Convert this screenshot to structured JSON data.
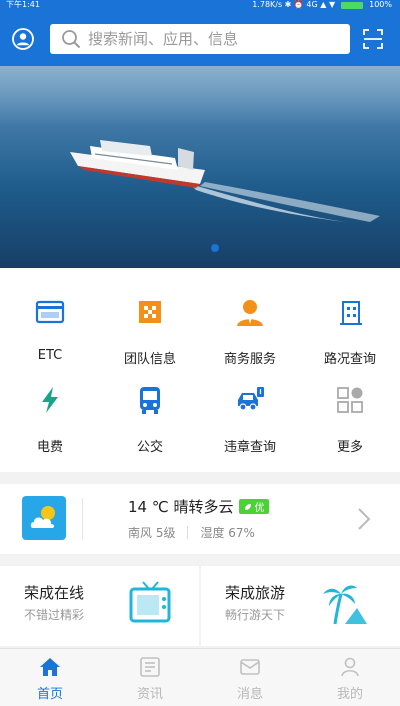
{
  "status_bar": {
    "time": "下午1:41",
    "network": "1.78K/s ✱ ⏰ 4G ▲ ▼",
    "battery": "100%"
  },
  "search": {
    "placeholder": "搜索新闻、应用、信息"
  },
  "grid": {
    "items": [
      {
        "label": "ETC",
        "icon": "etc-card-icon"
      },
      {
        "label": "团队信息",
        "icon": "team-grid-icon"
      },
      {
        "label": "商务服务",
        "icon": "business-person-icon"
      },
      {
        "label": "路况查询",
        "icon": "road-building-icon"
      },
      {
        "label": "电费",
        "icon": "lightning-icon"
      },
      {
        "label": "公交",
        "icon": "bus-icon"
      },
      {
        "label": "违章查询",
        "icon": "car-violation-icon"
      },
      {
        "label": "更多",
        "icon": "more-grid-icon"
      }
    ]
  },
  "weather": {
    "summary": "14 ℃ 晴转多云",
    "aqi": "优",
    "wind": "南风 5级",
    "humidity": "湿度 67%"
  },
  "promos": [
    {
      "title": "荣成在线",
      "subtitle": "不错过精彩",
      "icon": "tv-icon"
    },
    {
      "title": "荣成旅游",
      "subtitle": "畅行游天下",
      "icon": "palm-tree-icon"
    }
  ],
  "tabs": [
    {
      "label": "首页",
      "icon": "home-icon",
      "active": true
    },
    {
      "label": "资讯",
      "icon": "news-icon",
      "active": false
    },
    {
      "label": "消息",
      "icon": "message-icon",
      "active": false
    },
    {
      "label": "我的",
      "icon": "profile-icon",
      "active": false
    }
  ],
  "colors": {
    "primary": "#1a73d6",
    "accent_orange": "#f39019",
    "aqi_green": "#4cd137"
  }
}
